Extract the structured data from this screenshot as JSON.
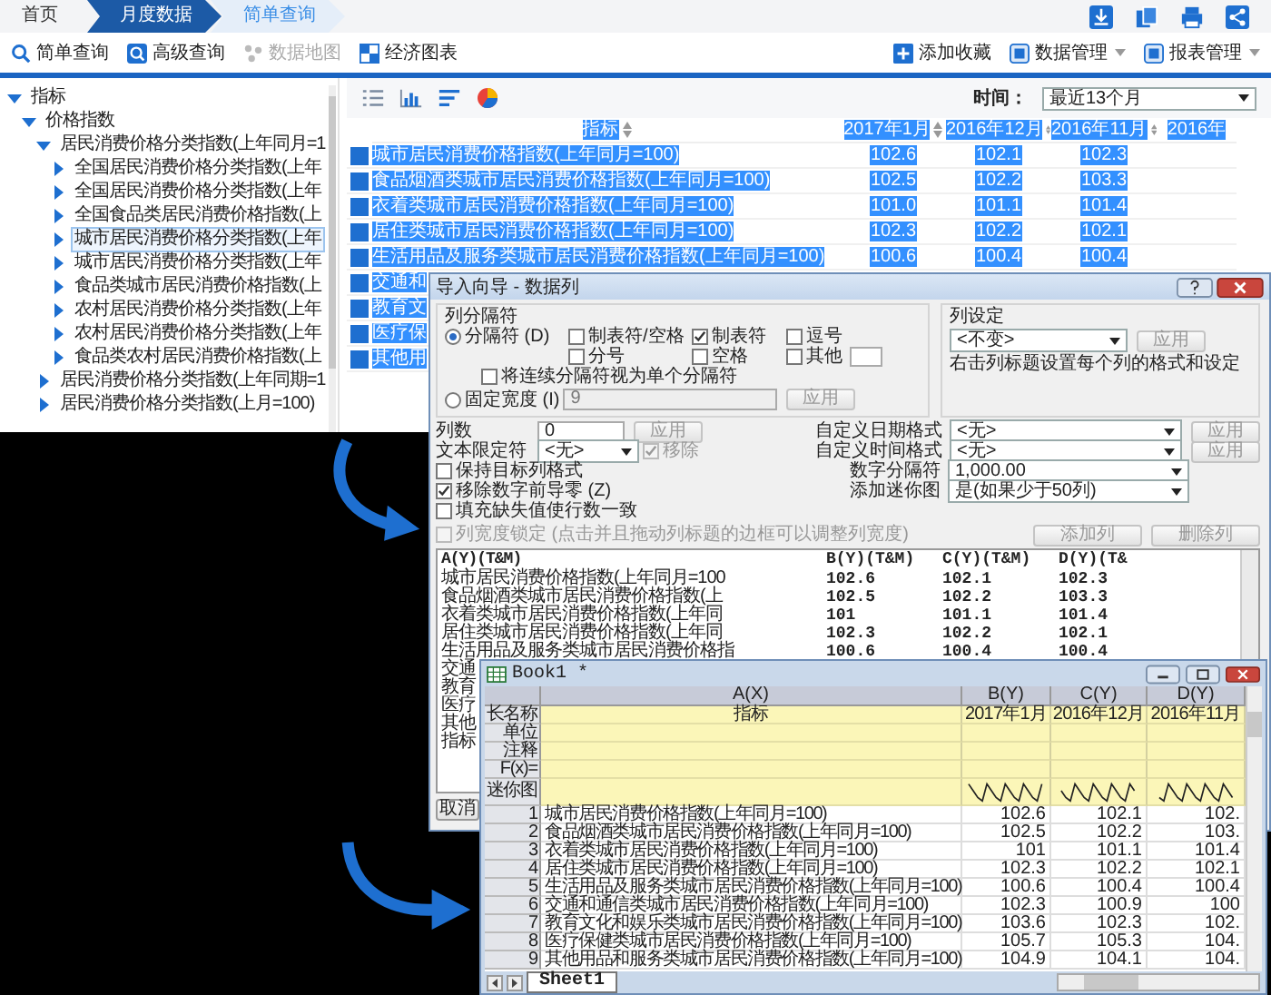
{
  "web": {
    "breadcrumb": [
      {
        "label": "首页",
        "selected": false
      },
      {
        "label": "月度数据",
        "selected": true
      },
      {
        "label": "简单查询",
        "selected": false
      }
    ],
    "toolbar_left": [
      {
        "label": "简单查询",
        "disabled": false
      },
      {
        "label": "高级查询",
        "disabled": false
      },
      {
        "label": "数据地图",
        "disabled": true
      },
      {
        "label": "经济图表",
        "disabled": false
      }
    ],
    "toolbar_right": [
      {
        "label": "添加收藏",
        "dropdown": false
      },
      {
        "label": "数据管理",
        "dropdown": true
      },
      {
        "label": "报表管理",
        "dropdown": true
      }
    ],
    "tree": [
      {
        "label": "指标",
        "expanded": true,
        "selected": false,
        "children": [
          {
            "label": "价格指数",
            "expanded": true,
            "selected": false,
            "children": [
              {
                "label": "居民消费价格分类指数(上年同月=1",
                "expanded": true,
                "selected": false,
                "children": [
                  {
                    "label": "全国居民消费价格分类指数(上年",
                    "expanded": false,
                    "selected": false
                  },
                  {
                    "label": "全国居民消费价格分类指数(上年",
                    "expanded": false,
                    "selected": false
                  },
                  {
                    "label": "全国食品类居民消费价格指数(上",
                    "expanded": false,
                    "selected": false
                  },
                  {
                    "label": "城市居民消费价格分类指数(上年",
                    "expanded": false,
                    "selected": true
                  },
                  {
                    "label": "城市居民消费价格分类指数(上年",
                    "expanded": false,
                    "selected": false
                  },
                  {
                    "label": "食品类城市居民消费价格指数(上",
                    "expanded": false,
                    "selected": false
                  },
                  {
                    "label": "农村居民消费价格分类指数(上年",
                    "expanded": false,
                    "selected": false
                  },
                  {
                    "label": "农村居民消费价格分类指数(上年",
                    "expanded": false,
                    "selected": false
                  },
                  {
                    "label": "食品类农村居民消费价格指数(上",
                    "expanded": false,
                    "selected": false
                  }
                ]
              },
              {
                "label": "居民消费价格分类指数(上年同期=1",
                "expanded": false,
                "selected": false
              },
              {
                "label": "居民消费价格分类指数(上月=100)",
                "expanded": false,
                "selected": false
              }
            ]
          }
        ]
      }
    ],
    "time_label": "时间：",
    "time_value": "最近13个月",
    "table": {
      "columns": [
        "指标",
        "2017年1月",
        "2016年12月",
        "2016年11月",
        "2016年"
      ],
      "rows": [
        {
          "selected": true,
          "cells": [
            "城市居民消费价格指数(上年同月=100)",
            "102.6",
            "102.1",
            "102.3"
          ]
        },
        {
          "selected": true,
          "cells": [
            "食品烟酒类城市居民消费价格指数(上年同月=100)",
            "102.5",
            "102.2",
            "103.3"
          ]
        },
        {
          "selected": true,
          "cells": [
            "衣着类城市居民消费价格指数(上年同月=100)",
            "101.0",
            "101.1",
            "101.4"
          ]
        },
        {
          "selected": true,
          "cells": [
            "居住类城市居民消费价格指数(上年同月=100)",
            "102.3",
            "102.2",
            "102.1"
          ]
        },
        {
          "selected": true,
          "cells": [
            "生活用品及服务类城市居民消费价格指数(上年同月=100)",
            "100.6",
            "100.4",
            "100.4"
          ]
        },
        {
          "selected": true,
          "cells": [
            "交通和"
          ]
        },
        {
          "selected": true,
          "cells": [
            "教育文"
          ]
        },
        {
          "selected": true,
          "cells": [
            "医疗保"
          ]
        },
        {
          "selected": true,
          "cells": [
            "其他用"
          ]
        }
      ]
    }
  },
  "import_dialog": {
    "title": "导入向导 - 数据列",
    "separator_group": "列分隔符",
    "modes": [
      {
        "label": "分隔符 (D)",
        "selected": true
      },
      {
        "label": "固定宽度 (I)",
        "selected": false
      }
    ],
    "delimiters": [
      {
        "label": "制表符/空格",
        "checked": false
      },
      {
        "label": "制表符",
        "checked": true
      },
      {
        "label": "逗号",
        "checked": false
      },
      {
        "label": "分号",
        "checked": false
      },
      {
        "label": "空格",
        "checked": false
      },
      {
        "label": "其他",
        "checked": false
      }
    ],
    "merge_delimiters": {
      "label": "将连续分隔符视为单个分隔符",
      "checked": false
    },
    "fixed_width": {
      "value": "9",
      "apply": {
        "label": "应用",
        "disabled": true
      }
    },
    "column_settings": {
      "title": "列设定",
      "value": "<不变>",
      "apply": {
        "label": "应用",
        "disabled": true
      },
      "hint": "右击列标题设置每个列的格式和设定"
    },
    "column_count": {
      "label": "列数",
      "value": "0",
      "apply": {
        "label": "应用",
        "disabled": true
      }
    },
    "text_qualifier": {
      "label": "文本限定符",
      "value": "<无>",
      "remove": {
        "label": "移除",
        "checked": true,
        "disabled": true
      }
    },
    "formats": [
      {
        "label": "自定义日期格式",
        "value": "<无>",
        "apply": {
          "label": "应用",
          "disabled": true
        }
      },
      {
        "label": "自定义时间格式",
        "value": "<无>",
        "apply": {
          "label": "应用",
          "disabled": true
        }
      },
      {
        "label": "数字分隔符",
        "value": "1,000.00"
      },
      {
        "label": "添加迷你图",
        "value": "是(如果少于50列)"
      }
    ],
    "options": [
      {
        "label": "保持目标列格式",
        "checked": false,
        "disabled": false
      },
      {
        "label": "移除数字前导零 (Z)",
        "checked": true,
        "disabled": false
      },
      {
        "label": "填充缺失值使行数一致",
        "checked": false,
        "disabled": false
      },
      {
        "label": "列宽度锁定 (点击并且拖动列标题的边框可以调整列宽度)",
        "checked": false,
        "disabled": true
      }
    ],
    "column_buttons": [
      {
        "label": "添加列",
        "disabled": true
      },
      {
        "label": "删除列",
        "disabled": true
      }
    ],
    "preview": {
      "columns": [
        "A(Y)(T&M)",
        "B(Y)(T&M)",
        "C(Y)(T&M)",
        "D(Y)(T&"
      ],
      "rows": [
        [
          "城市居民消费价格指数(上年同月=100",
          "102.6",
          "102.1",
          "102.3"
        ],
        [
          "食品烟酒类城市居民消费价格指数(上",
          "102.5",
          "102.2",
          "103.3"
        ],
        [
          "衣着类城市居民消费价格指数(上年同",
          "101",
          "101.1",
          "101.4"
        ],
        [
          "居住类城市居民消费价格指数(上年同",
          "102.3",
          "102.2",
          "102.1"
        ],
        [
          "生活用品及服务类城市居民消费价格指",
          "100.6",
          "100.4",
          "100.4"
        ],
        [
          "交通"
        ],
        [
          "教育"
        ],
        [
          "医疗"
        ],
        [
          "其他"
        ],
        [
          "指标"
        ]
      ]
    },
    "cancel": "取消"
  },
  "book": {
    "title": "Book1 *",
    "columns": [
      {
        "name": "A(X)",
        "long_name": "指标",
        "sparkline": false
      },
      {
        "name": "B(Y)",
        "long_name": "2017年1月",
        "sparkline": true
      },
      {
        "name": "C(Y)",
        "long_name": "2016年12月",
        "sparkline": true
      },
      {
        "name": "D(Y)",
        "long_name": "2016年11月",
        "sparkline": true
      }
    ],
    "header_rows": [
      "长名称",
      "单位",
      "注释",
      "F(x)=",
      "迷你图"
    ],
    "rows": [
      {
        "index": "1",
        "cells": [
          "城市居民消费价格指数(上年同月=100)",
          "102.6",
          "102.1",
          "102."
        ]
      },
      {
        "index": "2",
        "cells": [
          "食品烟酒类城市居民消费价格指数(上年同月=100)",
          "102.5",
          "102.2",
          "103."
        ]
      },
      {
        "index": "3",
        "cells": [
          "衣着类城市居民消费价格指数(上年同月=100)",
          "101",
          "101.1",
          "101.4"
        ]
      },
      {
        "index": "4",
        "cells": [
          "居住类城市居民消费价格指数(上年同月=100)",
          "102.3",
          "102.2",
          "102.1"
        ]
      },
      {
        "index": "5",
        "cells": [
          "生活用品及服务类城市居民消费价格指数(上年同月=100)",
          "100.6",
          "100.4",
          "100.4"
        ]
      },
      {
        "index": "6",
        "cells": [
          "交通和通信类城市居民消费价格指数(上年同月=100)",
          "102.3",
          "100.9",
          "100"
        ]
      },
      {
        "index": "7",
        "cells": [
          "教育文化和娱乐类城市居民消费价格指数(上年同月=100)",
          "103.6",
          "102.3",
          "102."
        ]
      },
      {
        "index": "8",
        "cells": [
          "医疗保健类城市居民消费价格指数(上年同月=100)",
          "105.7",
          "105.3",
          "104."
        ]
      },
      {
        "index": "9",
        "cells": [
          "其他用品和服务类城市居民消费价格指数(上年同月=100)",
          "104.9",
          "104.1",
          "104."
        ]
      }
    ],
    "sheet": "Sheet1"
  }
}
